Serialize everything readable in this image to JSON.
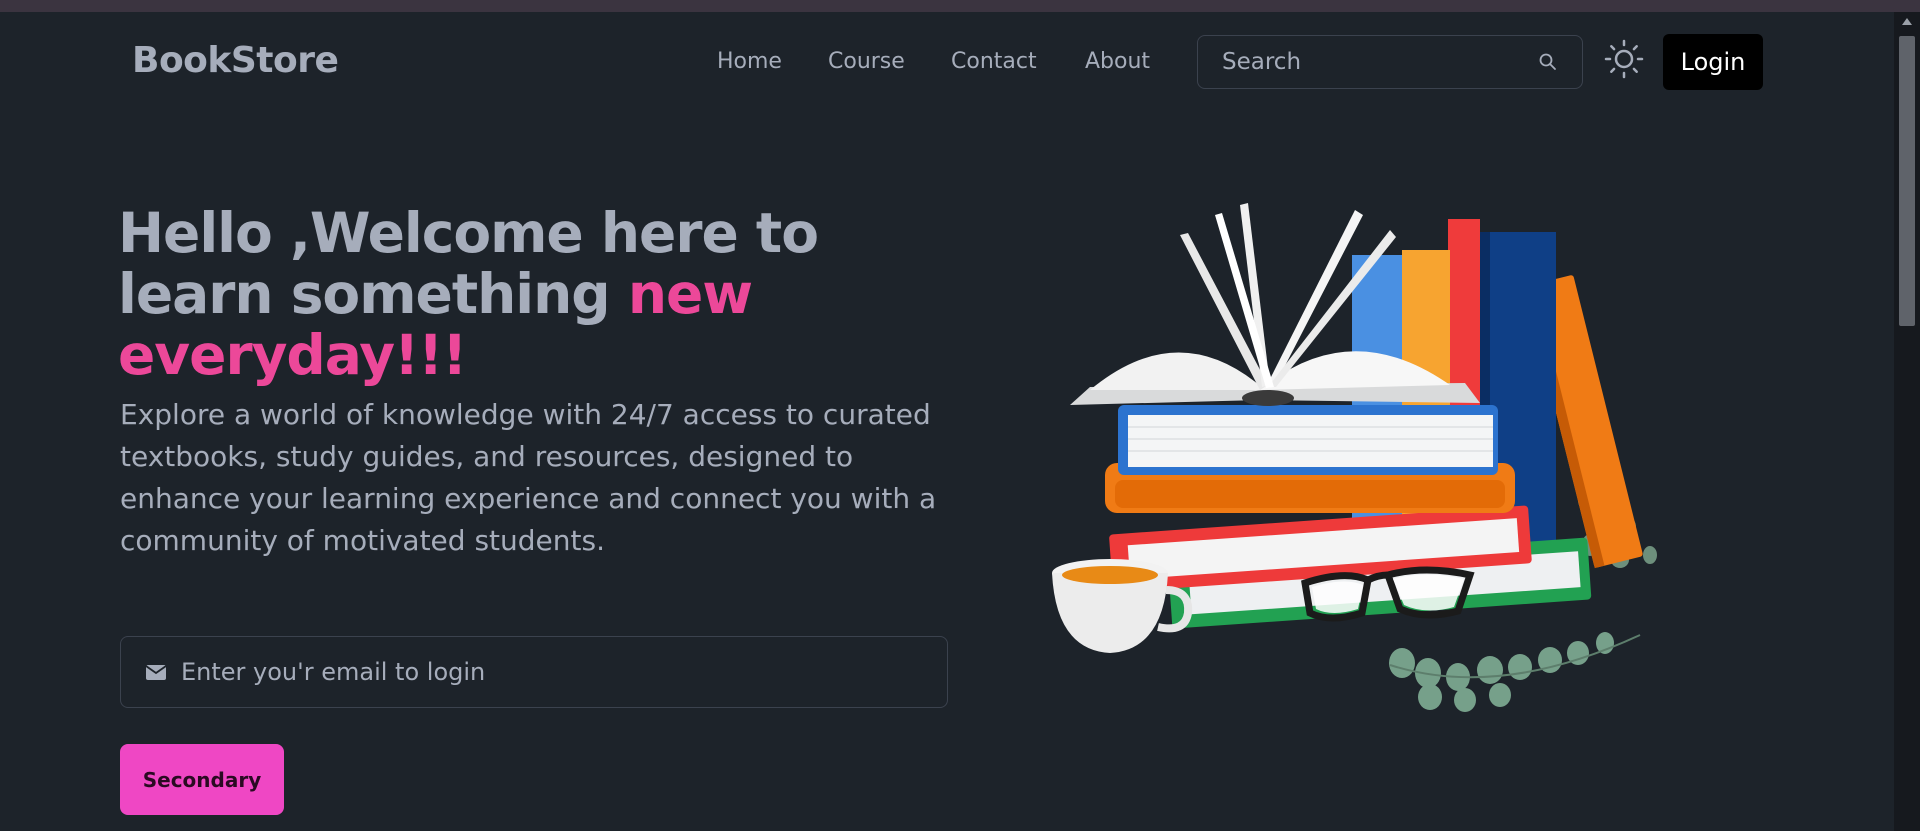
{
  "brand": "BookStore",
  "nav": {
    "items": [
      {
        "label": "Home"
      },
      {
        "label": "Course"
      },
      {
        "label": "Contact"
      },
      {
        "label": "About"
      }
    ]
  },
  "search": {
    "placeholder": "Search",
    "icon": "search-icon"
  },
  "theme_toggle": {
    "icon": "sun-icon"
  },
  "login": {
    "label": "Login"
  },
  "hero": {
    "title_part1": "Hello ,Welcome here to learn something ",
    "title_accent": "new everyday!!!",
    "description": "Explore a world of knowledge with 24/7 access to curated textbooks, study guides, and resources, designed to enhance your learning experience and connect you with a community of motivated students."
  },
  "email": {
    "placeholder": "Enter you'r email to login",
    "icon": "mail-icon"
  },
  "secondary_button": {
    "label": "Secondary"
  },
  "illustration": {
    "icon": "books-illustration"
  },
  "colors": {
    "background": "#1d232a",
    "text": "#a6adbb",
    "accent": "#ec4899",
    "button_pink": "#ef47c4",
    "login_bg": "#000000"
  }
}
